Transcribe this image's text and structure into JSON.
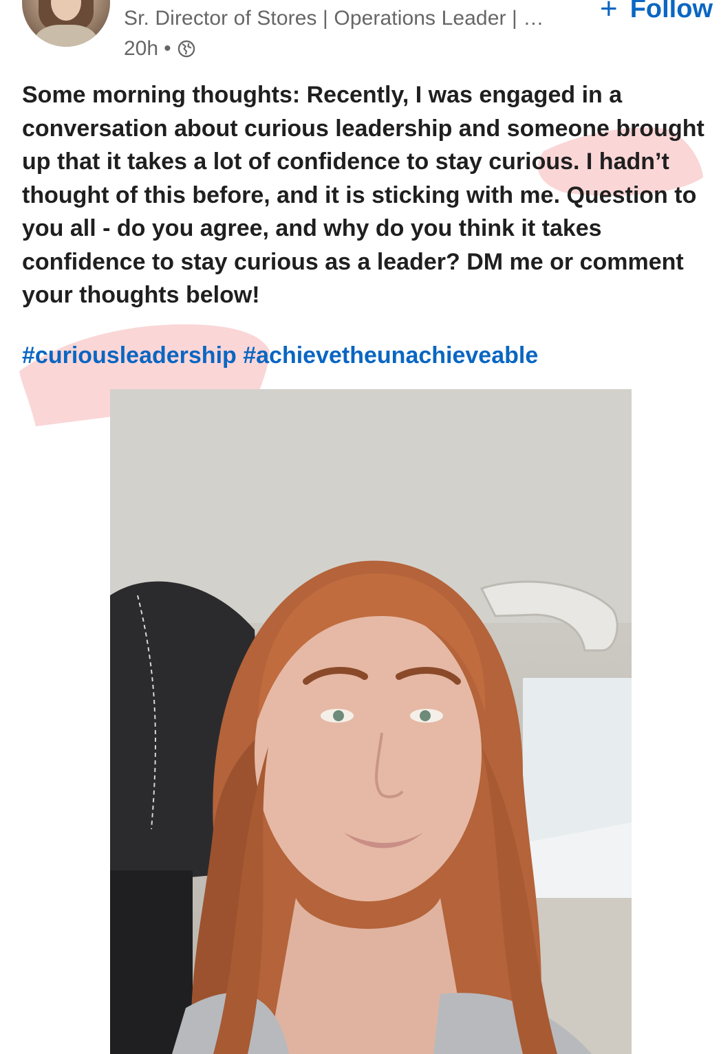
{
  "author": {
    "subtitle": "Sr. Director of Stores | Operations Leader | …",
    "time": "20h",
    "separator": "•",
    "visibility_icon": "globe-icon"
  },
  "follow": {
    "icon": "plus-icon",
    "label": "Follow"
  },
  "post": {
    "text": "Some morning thoughts:  Recently, I was engaged in a conversation about curious leadership and someone brought up that it takes a lot of confidence to stay curious.  I hadn’t thought of this before, and it is sticking with me. Question to you all - do you agree, and why do you think it takes confidence to stay curious as a leader?  DM me or comment your thoughts below!",
    "hashtag_1": "#curiousleadership",
    "hashtag_2": "#achievetheunachieveable"
  },
  "media": {
    "type": "video selfie in car"
  },
  "colors": {
    "link": "#0a66c2",
    "text": "#1f1f1f",
    "muted": "#666666",
    "highlight": "#f7b5b8"
  }
}
